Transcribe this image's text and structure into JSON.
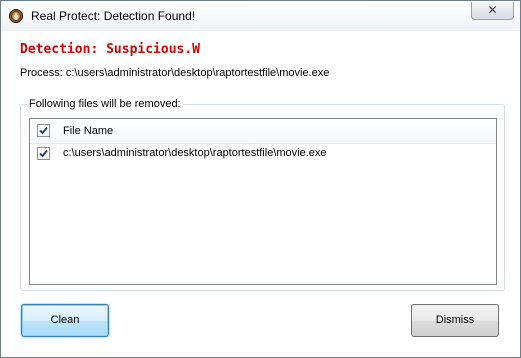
{
  "window": {
    "title": "Real Protect: Detection Found!",
    "close_glyph": "✕"
  },
  "detection": {
    "title": "Detection: Suspicious.W",
    "process_label": "Process: c:\\users\\administrator\\desktop\\raptortestfile\\movie.exe"
  },
  "group": {
    "label": "Following files will be removed:"
  },
  "file_list": {
    "header": "File Name",
    "header_checked": true,
    "rows": [
      {
        "path": "c:\\users\\administrator\\desktop\\raptortestfile\\movie.exe",
        "checked": true
      }
    ]
  },
  "buttons": {
    "clean": "Clean",
    "dismiss": "Dismiss"
  },
  "colors": {
    "detection_red": "#d40000",
    "focus_blue": "#3c7fb1"
  },
  "icons": {
    "app": "raptor-shield-icon",
    "close": "close-icon",
    "check": "checkmark-icon"
  }
}
